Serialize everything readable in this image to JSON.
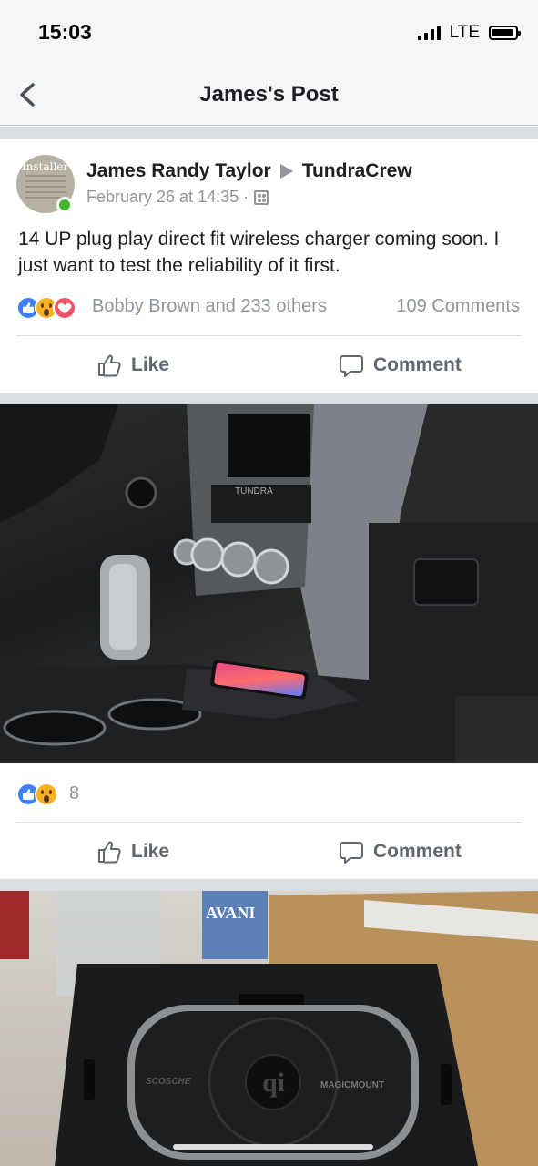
{
  "status_bar": {
    "time": "15:03",
    "network": "LTE"
  },
  "nav": {
    "title": "James's Post"
  },
  "post": {
    "author": "James Randy Taylor",
    "group": "TundraCrew",
    "date": "February 26 at 14:35 ·",
    "text": "14 UP plug play direct fit wireless charger coming soon. I just want to test the reliability of it first.",
    "reactions_text": "Bobby Brown and 233 others",
    "comments_text": "109 Comments",
    "avatar_caption": "Installer",
    "like_label": "Like",
    "comment_label": "Comment"
  },
  "photo1": {
    "reaction_count": "8",
    "like_label": "Like",
    "comment_label": "Comment",
    "dash_logo": "TUNDRA"
  },
  "photo2": {
    "bottle_brand": "AVANI",
    "charger_brand_left": "SCOSCHE",
    "charger_brand_right": "MAGICMOUNT"
  },
  "colors": {
    "fb_blue": "#4080ff",
    "wow_yellow": "#f7b125",
    "love_red": "#f25268",
    "online_green": "#42b72a",
    "meta_gray": "#90949c"
  },
  "icons": [
    "back-chevron-icon",
    "signal-icon",
    "battery-icon",
    "privacy-icon",
    "like-reaction-icon",
    "wow-reaction-icon",
    "love-reaction-icon",
    "like-icon",
    "comment-icon"
  ]
}
